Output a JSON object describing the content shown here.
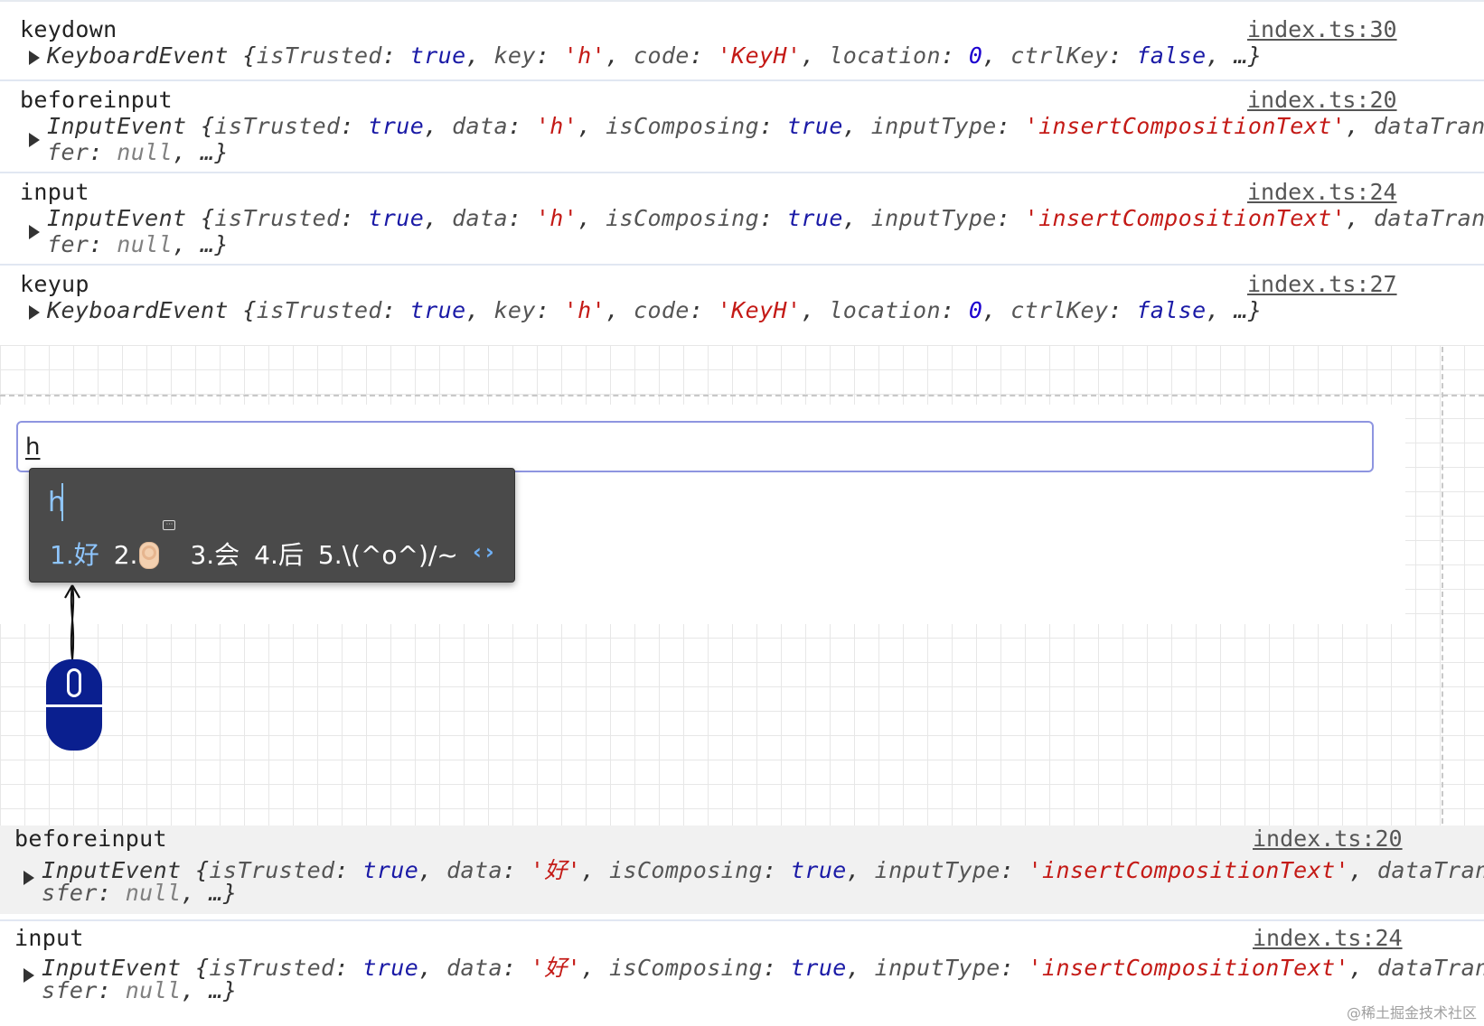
{
  "top_logs": [
    {
      "event": "keydown",
      "source": "index.ts:30",
      "lines": [
        [
          [
            "p",
            "KeyboardEvent {"
          ],
          [
            "k",
            "isTrusted"
          ],
          [
            "p",
            ": "
          ],
          [
            "b",
            "true"
          ],
          [
            "p",
            ", "
          ],
          [
            "k",
            "key"
          ],
          [
            "p",
            ": "
          ],
          [
            "s",
            "'h'"
          ],
          [
            "p",
            ", "
          ],
          [
            "k",
            "code"
          ],
          [
            "p",
            ": "
          ],
          [
            "s",
            "'KeyH'"
          ],
          [
            "p",
            ", "
          ],
          [
            "k",
            "location"
          ],
          [
            "p",
            ": "
          ],
          [
            "n",
            "0"
          ],
          [
            "p",
            ", "
          ],
          [
            "k",
            "ctrlKey"
          ],
          [
            "p",
            ": "
          ],
          [
            "b",
            "false"
          ],
          [
            "p",
            ", …}"
          ]
        ]
      ]
    },
    {
      "event": "beforeinput",
      "source": "index.ts:20",
      "lines": [
        [
          [
            "p",
            "InputEvent {"
          ],
          [
            "k",
            "isTrusted"
          ],
          [
            "p",
            ": "
          ],
          [
            "b",
            "true"
          ],
          [
            "p",
            ", "
          ],
          [
            "k",
            "data"
          ],
          [
            "p",
            ": "
          ],
          [
            "s",
            "'h'"
          ],
          [
            "p",
            ", "
          ],
          [
            "k",
            "isComposing"
          ],
          [
            "p",
            ": "
          ],
          [
            "b",
            "true"
          ],
          [
            "p",
            ", "
          ],
          [
            "k",
            "inputType"
          ],
          [
            "p",
            ": "
          ],
          [
            "s",
            "'insertCompositionText'"
          ],
          [
            "p",
            ", "
          ],
          [
            "k",
            "dataTrans"
          ]
        ],
        [
          [
            "k",
            "fer"
          ],
          [
            "p",
            ": "
          ],
          [
            "nul",
            "null"
          ],
          [
            "p",
            ", …}"
          ]
        ]
      ]
    },
    {
      "event": "input",
      "source": "index.ts:24",
      "lines": [
        [
          [
            "p",
            "InputEvent {"
          ],
          [
            "k",
            "isTrusted"
          ],
          [
            "p",
            ": "
          ],
          [
            "b",
            "true"
          ],
          [
            "p",
            ", "
          ],
          [
            "k",
            "data"
          ],
          [
            "p",
            ": "
          ],
          [
            "s",
            "'h'"
          ],
          [
            "p",
            ", "
          ],
          [
            "k",
            "isComposing"
          ],
          [
            "p",
            ": "
          ],
          [
            "b",
            "true"
          ],
          [
            "p",
            ", "
          ],
          [
            "k",
            "inputType"
          ],
          [
            "p",
            ": "
          ],
          [
            "s",
            "'insertCompositionText'"
          ],
          [
            "p",
            ", "
          ],
          [
            "k",
            "dataTrans"
          ]
        ],
        [
          [
            "k",
            "fer"
          ],
          [
            "p",
            ": "
          ],
          [
            "nul",
            "null"
          ],
          [
            "p",
            ", …}"
          ]
        ]
      ]
    },
    {
      "event": "keyup",
      "source": "index.ts:27",
      "lines": [
        [
          [
            "p",
            "KeyboardEvent {"
          ],
          [
            "k",
            "isTrusted"
          ],
          [
            "p",
            ": "
          ],
          [
            "b",
            "true"
          ],
          [
            "p",
            ", "
          ],
          [
            "k",
            "key"
          ],
          [
            "p",
            ": "
          ],
          [
            "s",
            "'h'"
          ],
          [
            "p",
            ", "
          ],
          [
            "k",
            "code"
          ],
          [
            "p",
            ": "
          ],
          [
            "s",
            "'KeyH'"
          ],
          [
            "p",
            ", "
          ],
          [
            "k",
            "location"
          ],
          [
            "p",
            ": "
          ],
          [
            "n",
            "0"
          ],
          [
            "p",
            ", "
          ],
          [
            "k",
            "ctrlKey"
          ],
          [
            "p",
            ": "
          ],
          [
            "b",
            "false"
          ],
          [
            "p",
            ", …}"
          ]
        ]
      ]
    }
  ],
  "bottom_logs": [
    {
      "event": "beforeinput",
      "source": "index.ts:20",
      "lines": [
        [
          [
            "p",
            "InputEvent {"
          ],
          [
            "k",
            "isTrusted"
          ],
          [
            "p",
            ": "
          ],
          [
            "b",
            "true"
          ],
          [
            "p",
            ", "
          ],
          [
            "k",
            "data"
          ],
          [
            "p",
            ": "
          ],
          [
            "s",
            "'好'"
          ],
          [
            "p",
            ", "
          ],
          [
            "k",
            "isComposing"
          ],
          [
            "p",
            ": "
          ],
          [
            "b",
            "true"
          ],
          [
            "p",
            ", "
          ],
          [
            "k",
            "inputType"
          ],
          [
            "p",
            ": "
          ],
          [
            "s",
            "'insertCompositionText'"
          ],
          [
            "p",
            ", "
          ],
          [
            "k",
            "dataTran"
          ]
        ],
        [
          [
            "k",
            "sfer"
          ],
          [
            "p",
            ": "
          ],
          [
            "nul",
            "null"
          ],
          [
            "p",
            ", …}"
          ]
        ]
      ]
    },
    {
      "event": "input",
      "source": "index.ts:24",
      "lines": [
        [
          [
            "p",
            "InputEvent {"
          ],
          [
            "k",
            "isTrusted"
          ],
          [
            "p",
            ": "
          ],
          [
            "b",
            "true"
          ],
          [
            "p",
            ", "
          ],
          [
            "k",
            "data"
          ],
          [
            "p",
            ": "
          ],
          [
            "s",
            "'好'"
          ],
          [
            "p",
            ", "
          ],
          [
            "k",
            "isComposing"
          ],
          [
            "p",
            ": "
          ],
          [
            "b",
            "true"
          ],
          [
            "p",
            ", "
          ],
          [
            "k",
            "inputType"
          ],
          [
            "p",
            ": "
          ],
          [
            "s",
            "'insertCompositionText'"
          ],
          [
            "p",
            ", "
          ],
          [
            "k",
            "dataTran"
          ]
        ],
        [
          [
            "k",
            "sfer"
          ],
          [
            "p",
            ": "
          ],
          [
            "nul",
            "null"
          ],
          [
            "p",
            ", …}"
          ]
        ]
      ]
    }
  ],
  "input_box": {
    "value": "h"
  },
  "ime": {
    "preedit": "h",
    "candidates": [
      "1.好",
      "2.",
      "3.会",
      "4.后",
      "5.\\(^o^)/~"
    ],
    "selected_index": 0,
    "prev_arrow": "‹",
    "next_arrow": "›"
  },
  "watermark": "@稀土掘金技术社区",
  "colors": {
    "string": "#c41a16",
    "boolean": "#1a1aa6",
    "number": "#1c00cf",
    "null": "#808080",
    "ime_accent": "#8fc6ff",
    "input_border": "#8e95e0",
    "mouse": "#0a1f8f"
  }
}
